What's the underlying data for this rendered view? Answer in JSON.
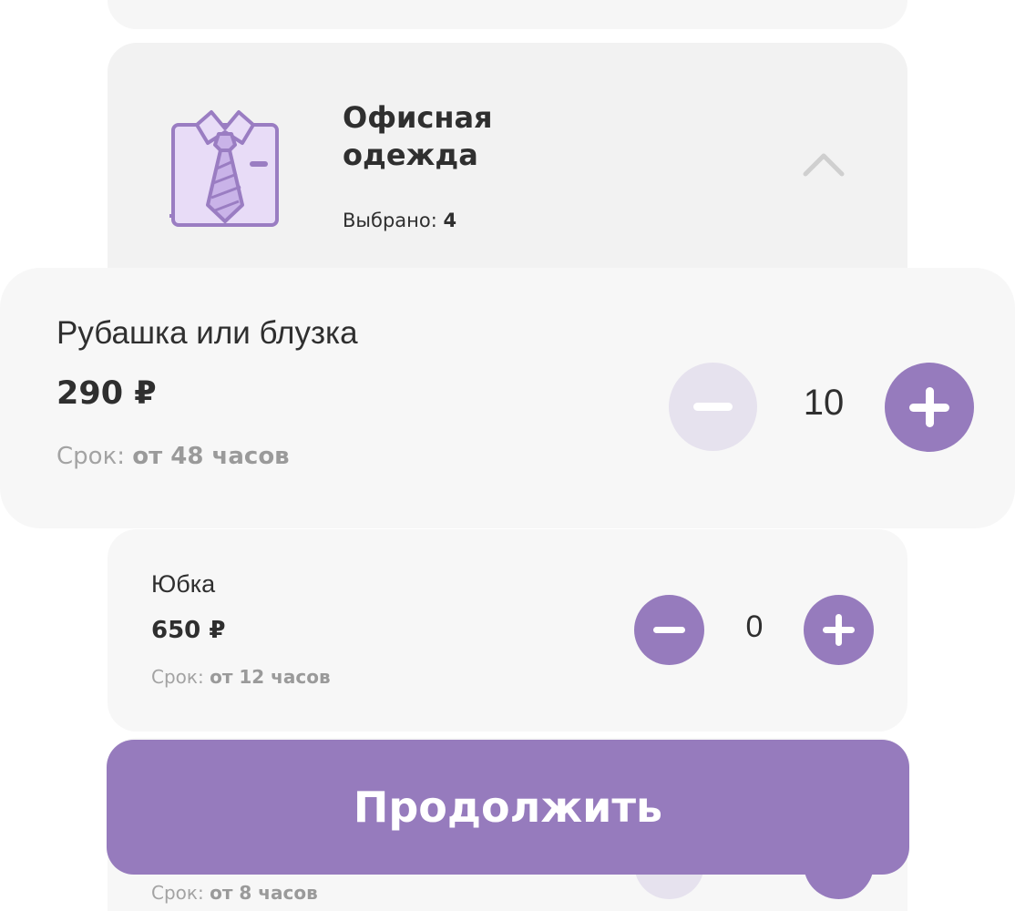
{
  "category": {
    "title": "Офисная\nодежда",
    "selected_label": "Выбрано: ",
    "selected_count": "4",
    "icon": "shirt-tie-icon",
    "chevron": "chevron-up-icon"
  },
  "items": [
    {
      "name": "Рубашка или блузка",
      "price": "290 ₽",
      "term_label": "Срок: ",
      "term_value": "от 48 часов",
      "quantity": "10"
    },
    {
      "name": "Юбка",
      "price": "650 ₽",
      "term_label": "Срок: ",
      "term_value": "от 12 часов",
      "quantity": "0"
    },
    {
      "term_label": "Срок: ",
      "term_value": "от 8 часов"
    }
  ],
  "continue_label": "Продолжить",
  "colors": {
    "accent": "#967bbd",
    "accent_disabled": "#e6e2ee",
    "card_bg": "#f7f7f7",
    "header_bg": "#f2f2f2",
    "icon_fill": "#e8dcf7",
    "icon_stroke": "#9a7dc2",
    "muted_text": "#a3a3a3"
  }
}
